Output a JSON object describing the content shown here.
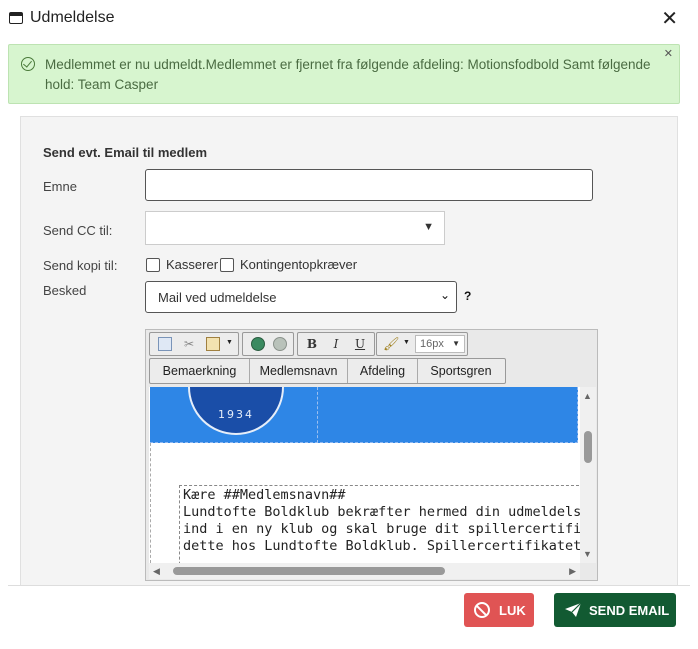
{
  "dialog": {
    "title": "Udmeldelse",
    "close_glyph": "✕"
  },
  "alert": {
    "message": "Medlemmet er nu udmeldt.Medlemmet er fjernet fra følgende afdeling: Motionsfodbold Samt følgende hold: Team Casper",
    "close_glyph": "✕",
    "color": "#d7f5cf"
  },
  "form": {
    "section_title": "Send evt. Email til medlem",
    "subject_label": "Emne",
    "subject_value": "",
    "cc_label": "Send CC til:",
    "cc_value": "",
    "copy_label": "Send kopi til:",
    "copy_options": [
      {
        "label": "Kasserer",
        "checked": false
      },
      {
        "label": "Kontingentopkræver",
        "checked": false
      }
    ],
    "message_label": "Besked",
    "message_template": "Mail ved udmeldelse",
    "help_glyph": "?"
  },
  "editor": {
    "toolbar_icons": [
      "copy-icon",
      "cut-icon",
      "paste-icon",
      "link-icon",
      "unlink-icon",
      "brush-icon"
    ],
    "format_buttons": {
      "bold": "B",
      "italic": "I",
      "underline": "U"
    },
    "font_size": "16px",
    "merge_tags": [
      "Bemaerkning",
      "Medlemsnavn",
      "Afdeling",
      "Sportsgren"
    ],
    "logo_text": "1934",
    "body_lines": [
      "Kære ##Medlemsnavn##",
      "",
      "Lundtofte Boldklub bekræfter hermed din udmeldelse. H",
      "ind i en ny klub og skal bruge dit spillercertifikat, vil din",
      "dette hos Lundtofte Boldklub. Spillercertifikatet udlevere"
    ],
    "band_color": "#2e86e6"
  },
  "footer": {
    "close_label": "LUK",
    "send_label": "SEND EMAIL",
    "close_color": "#e05454",
    "send_color": "#125a32"
  }
}
